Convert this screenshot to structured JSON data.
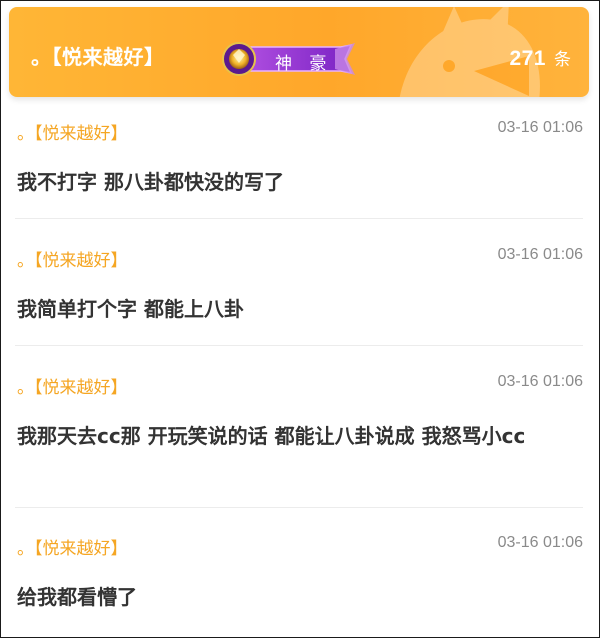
{
  "header": {
    "name": "。【悦来越好】",
    "badge_label": "神 豪",
    "count": "271",
    "count_unit": "条",
    "colors": {
      "bar": "#ffa72a",
      "badge": "#8c2fcf",
      "name_text": "#ffffff"
    }
  },
  "comments": [
    {
      "name": "。【悦来越好】",
      "time": "03-16 01:06",
      "text": "我不打字 那八卦都快没的写了"
    },
    {
      "name": "。【悦来越好】",
      "time": "03-16 01:06",
      "text": "我简单打个字 都能上八卦"
    },
    {
      "name": "。【悦来越好】",
      "time": "03-16 01:06",
      "text": "我那天去cc那 开玩笑说的话 都能让八卦说成 我怒骂小cc"
    },
    {
      "name": "。【悦来越好】",
      "time": "03-16 01:06",
      "text": "给我都看懵了"
    }
  ],
  "colors": {
    "username": "#f5a623",
    "timestamp": "#8a8a8a",
    "body_text": "#333333"
  }
}
